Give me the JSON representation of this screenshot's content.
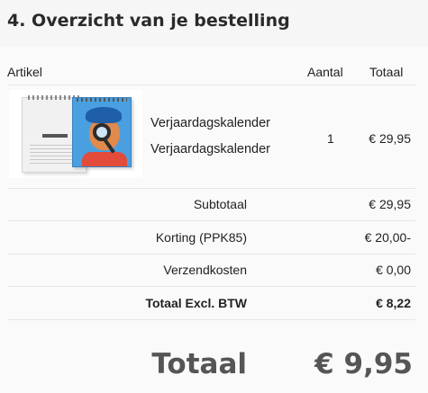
{
  "section": {
    "title": "4. Overzicht van je bestelling"
  },
  "table": {
    "columns": [
      "Artikel",
      "Aantal",
      "Totaal"
    ],
    "items": [
      {
        "name_line1": "Verjaardagskalender",
        "name_line2": "Verjaardagskalender",
        "quantity": "1",
        "total": "€ 29,95",
        "thumbnail_icon": "birthday-calendar-product-image"
      }
    ]
  },
  "summary": {
    "subtotal_label": "Subtotaal",
    "subtotal_value": "€ 29,95",
    "discount_label": "Korting (PPK85)",
    "discount_value": "€ 20,00-",
    "shipping_label": "Verzendkosten",
    "shipping_value": "€ 0,00",
    "total_excl_label": "Totaal Excl. BTW",
    "total_excl_value": "€ 8,22"
  },
  "grand_total": {
    "label": "Totaal",
    "value": "€ 9,95"
  }
}
